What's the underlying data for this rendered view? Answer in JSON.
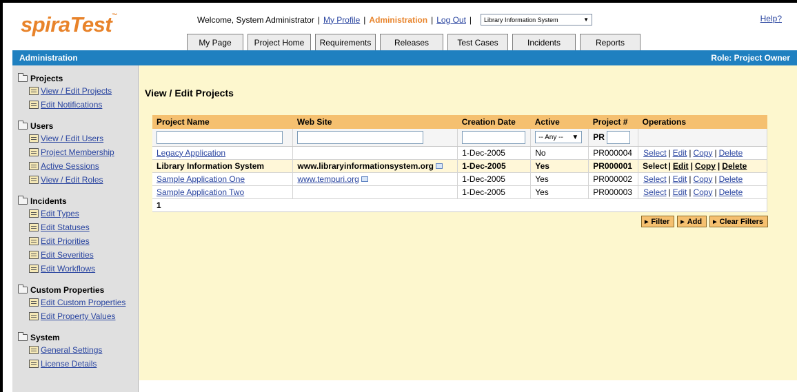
{
  "header": {
    "logo": "spiraTest",
    "logo_tm": "™",
    "welcome": "Welcome, System Administrator",
    "my_profile": "My Profile",
    "administration": "Administration",
    "log_out": "Log Out",
    "project_selected": "Library Information System",
    "help": "Help?"
  },
  "tabs": [
    "My Page",
    "Project Home",
    "Requirements",
    "Releases",
    "Test Cases",
    "Incidents",
    "Reports"
  ],
  "admin_bar": {
    "title": "Administration",
    "role": "Role: Project Owner"
  },
  "sidebar": {
    "sections": [
      {
        "title": "Projects",
        "items": [
          "View / Edit Projects",
          "Edit Notifications"
        ]
      },
      {
        "title": "Users",
        "items": [
          "View / Edit Users",
          "Project Membership",
          "Active Sessions",
          "View / Edit Roles"
        ]
      },
      {
        "title": "Incidents",
        "items": [
          "Edit Types",
          "Edit Statuses",
          "Edit Priorities",
          "Edit Severities",
          "Edit Workflows"
        ]
      },
      {
        "title": "Custom Properties",
        "items": [
          "Edit Custom Properties",
          "Edit Property Values"
        ]
      },
      {
        "title": "System",
        "items": [
          "General Settings",
          "License Details"
        ]
      }
    ]
  },
  "main": {
    "title": "View / Edit Projects",
    "columns": [
      "Project Name",
      "Web Site",
      "Creation Date",
      "Active",
      "Project #",
      "Operations"
    ],
    "filter": {
      "active_option": "-- Any --",
      "project_prefix": "PR"
    },
    "rows": [
      {
        "name": "Legacy Application",
        "website": "",
        "created": "1-Dec-2005",
        "active": "No",
        "number": "PR000004"
      },
      {
        "name": "Library Information System",
        "website": "www.libraryinformationsystem.org",
        "created": "1-Dec-2005",
        "active": "Yes",
        "number": "PR000001"
      },
      {
        "name": "Sample Application One",
        "website": "www.tempuri.org",
        "created": "1-Dec-2005",
        "active": "Yes",
        "number": "PR000002"
      },
      {
        "name": "Sample Application Two",
        "website": "",
        "created": "1-Dec-2005",
        "active": "Yes",
        "number": "PR000003"
      }
    ],
    "operations": {
      "select": "Select",
      "edit": "Edit",
      "copy": "Copy",
      "delete": "Delete"
    },
    "pager": "1",
    "buttons": {
      "filter": "Filter",
      "add": "Add",
      "clear": "Clear Filters"
    }
  }
}
